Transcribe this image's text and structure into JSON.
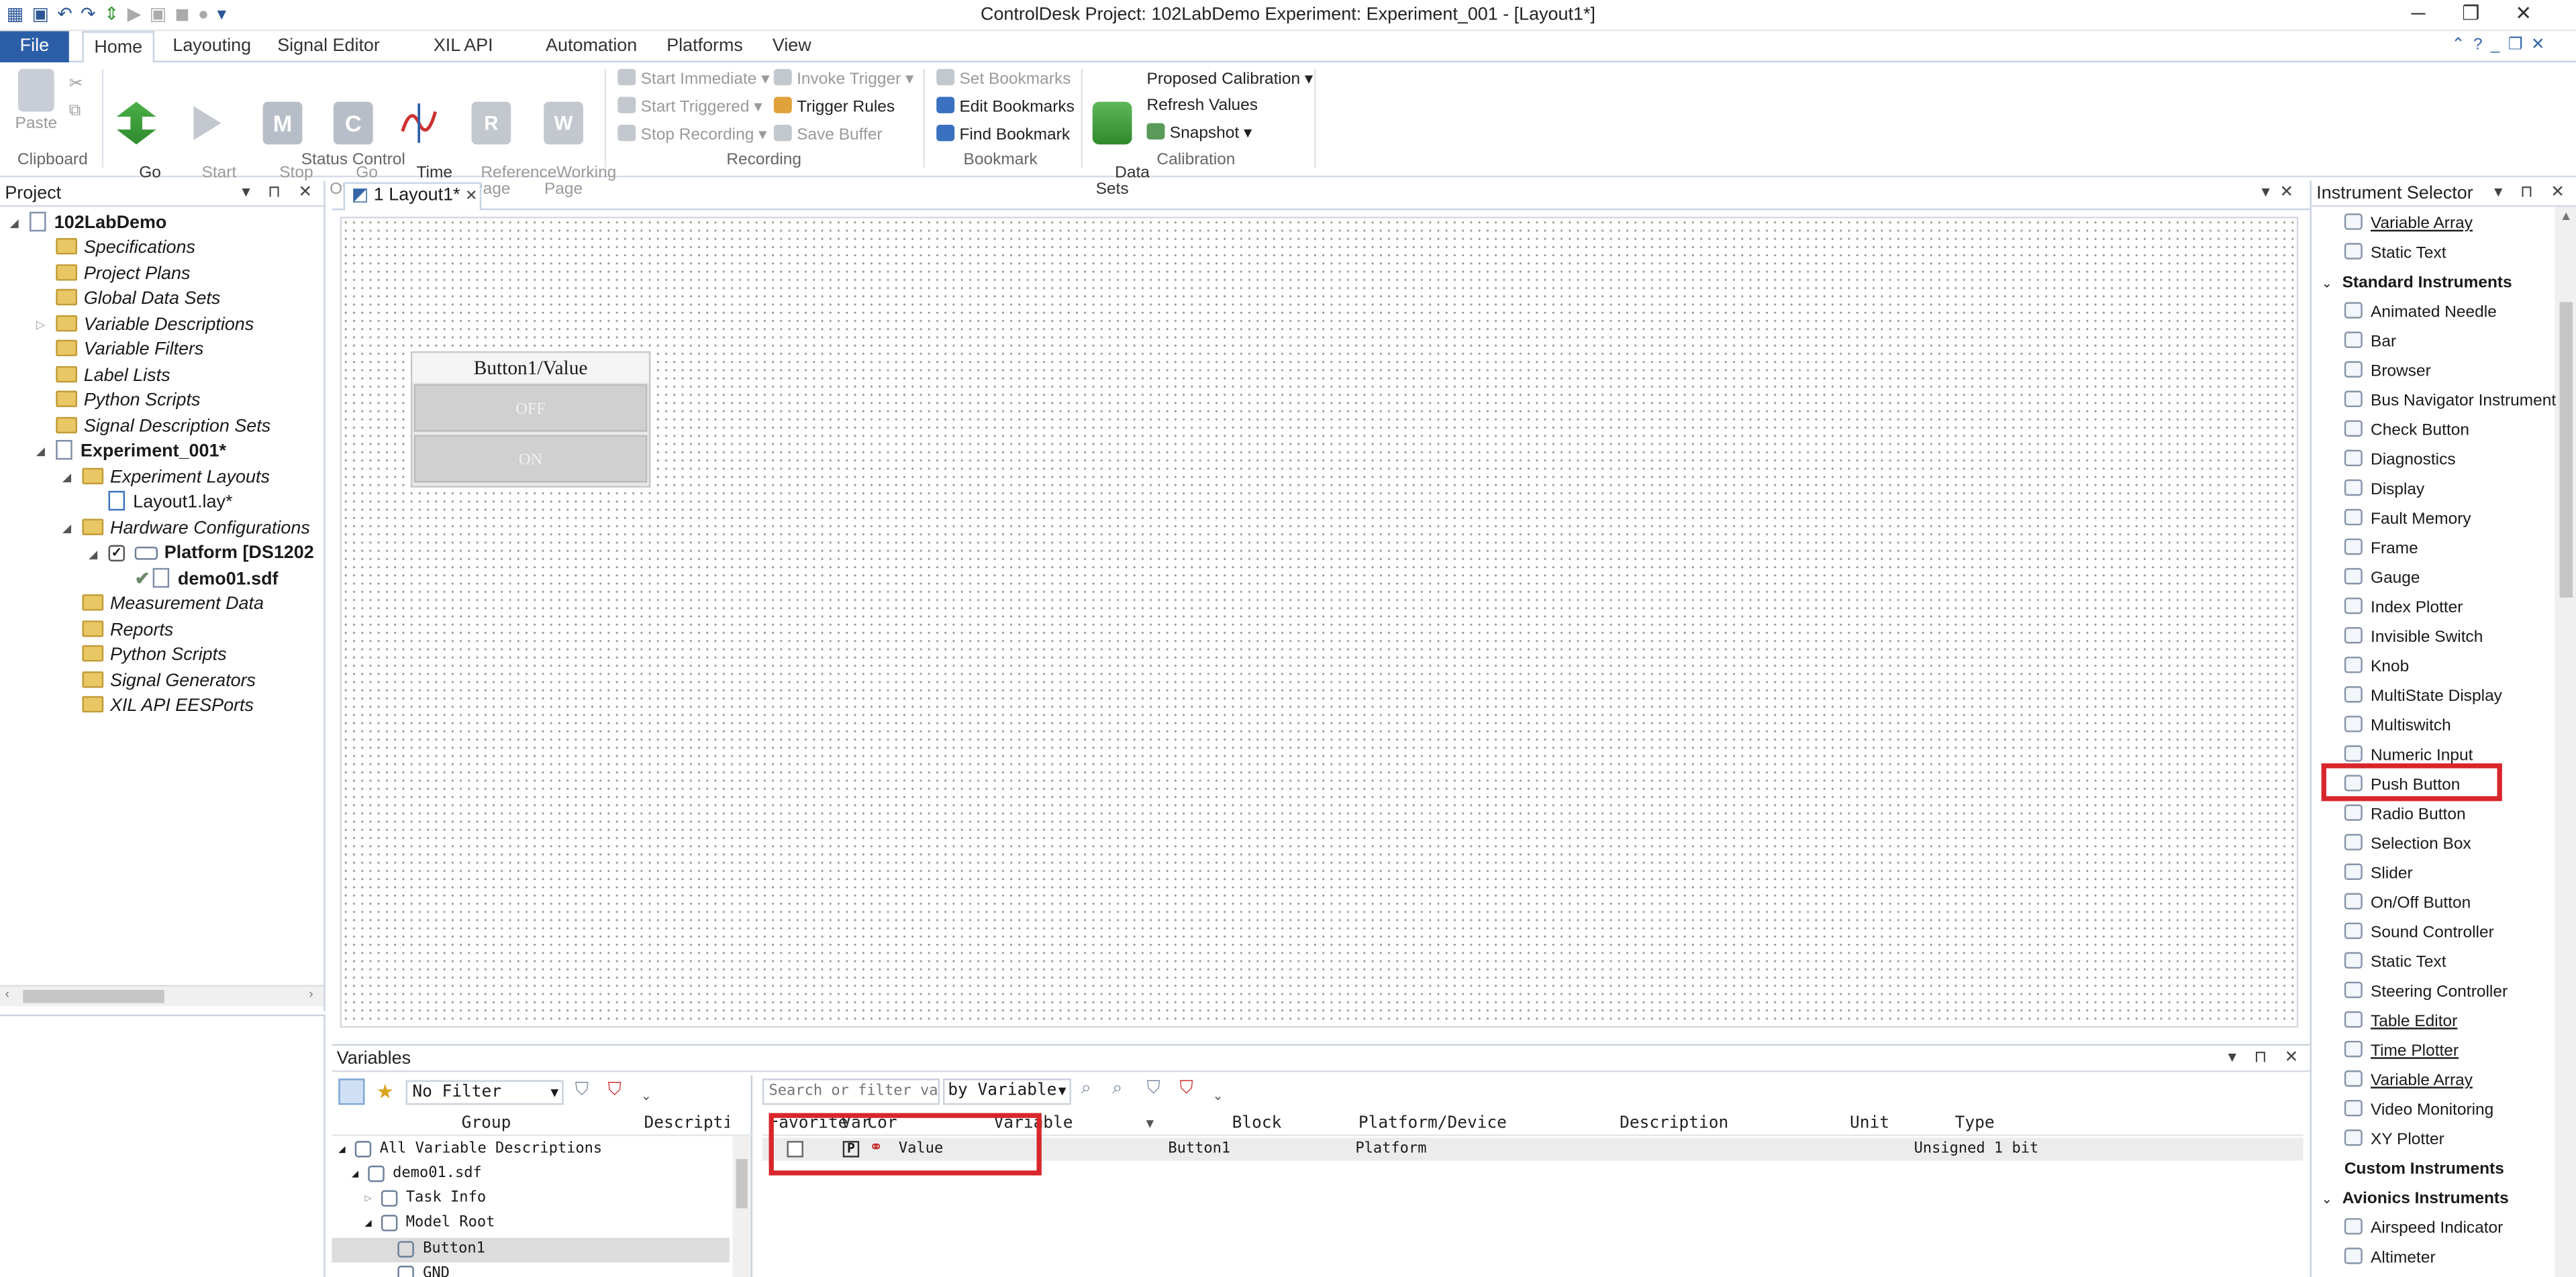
{
  "window": {
    "title": "ControlDesk  Project: 102LabDemo  Experiment: Experiment_001 - [Layout1*]"
  },
  "ribbon_tabs": [
    "File",
    "Home",
    "Layouting",
    "Signal Editor",
    "XIL API EESPort",
    "Automation",
    "Platforms",
    "View"
  ],
  "ribbon": {
    "paste": "Paste",
    "go_online": "Go\nOnline",
    "start_measuring": "Start\nMeasuring",
    "stop_measuring": "Stop\nMeasuring",
    "go_offline": "Go\nOffline",
    "time_cursor": "Time\nCursor",
    "reference_page": "Reference\nPage",
    "working_page": "Working\nPage",
    "start_immediate": "Start Immediate",
    "start_triggered": "Start Triggered",
    "stop_recording": "Stop Recording",
    "invoke_trigger": "Invoke Trigger",
    "trigger_rules": "Trigger Rules",
    "save_buffer": "Save Buffer",
    "set_bookmarks": "Set Bookmarks",
    "edit_bookmarks": "Edit Bookmarks",
    "find_bookmark": "Find Bookmark",
    "data_sets": "Data\nSets",
    "proposed_calibration": "Proposed Calibration",
    "refresh_values": "Refresh Values",
    "snapshot": "Snapshot",
    "groups": {
      "clipboard": "Clipboard",
      "status_control": "Status Control",
      "recording": "Recording",
      "bookmark": "Bookmark",
      "calibration": "Calibration"
    }
  },
  "project_panel": {
    "title": "Project",
    "root": "102LabDemo",
    "items": [
      "Specifications",
      "Project Plans",
      "Global Data Sets",
      "Variable Descriptions",
      "Variable Filters",
      "Label Lists",
      "Python Scripts",
      "Signal Description Sets"
    ],
    "experiment": "Experiment_001*",
    "experiment_layouts": "Experiment Layouts",
    "layout_file": "Layout1.lay*",
    "hardware_configurations": "Hardware Configurations",
    "platform": "Platform [DS1202",
    "sdf": "demo01.sdf",
    "experiment_items": [
      "Measurement Data",
      "Reports",
      "Python Scripts",
      "Signal Generators",
      "XIL API EESPorts"
    ]
  },
  "document_tab": {
    "label": "1  Layout1*"
  },
  "layout_canvas": {
    "instrument_title": "Button1/Value",
    "off_label": "OFF",
    "on_label": "ON"
  },
  "instrument_selector": {
    "title": "Instrument Selector",
    "top_items": [
      "Variable Array",
      "Static Text"
    ],
    "standard_header": "Standard Instruments",
    "standard_items": [
      "Animated Needle",
      "Bar",
      "Browser",
      "Bus Navigator Instrument",
      "Check Button",
      "Diagnostics",
      "Display",
      "Fault Memory",
      "Frame",
      "Gauge",
      "Index Plotter",
      "Invisible Switch",
      "Knob",
      "MultiState Display",
      "Multiswitch",
      "Numeric Input",
      "Push Button",
      "Radio Button",
      "Selection Box",
      "Slider",
      "On/Off Button",
      "Sound Controller",
      "Static Text",
      "Steering Controller",
      "Table Editor",
      "Time Plotter",
      "Variable Array",
      "Video Monitoring",
      "XY Plotter"
    ],
    "custom_header": "Custom Instruments",
    "avionics_header": "Avionics Instruments",
    "avionics_items": [
      "Airspeed Indicator",
      "Altimeter"
    ],
    "highlighted": "Push Button"
  },
  "variables_panel": {
    "title": "Variables",
    "filter_value": "No Filter",
    "search_placeholder": "Search or filter variables",
    "search_by": "by Variable",
    "left_headers": [
      "Group",
      "Descripti"
    ],
    "tree": [
      "All Variable Descriptions",
      "demo01.sdf",
      "Task Info",
      "Model Root",
      "Button1",
      "GND"
    ],
    "headers": [
      "Favorite",
      "Var",
      "Cor",
      "Variable",
      "Block",
      "Platform/Device",
      "Description",
      "Unit",
      "Type"
    ],
    "row": {
      "var_type": "P",
      "variable": "Value",
      "block": "Button1",
      "platform": "Platform",
      "description": "",
      "unit": "",
      "type": "Unsigned 1 bit"
    }
  },
  "colors": {
    "file_tab": "#2c5ea8",
    "highlight_box": "#d8262b",
    "folder": "#e9c765"
  }
}
